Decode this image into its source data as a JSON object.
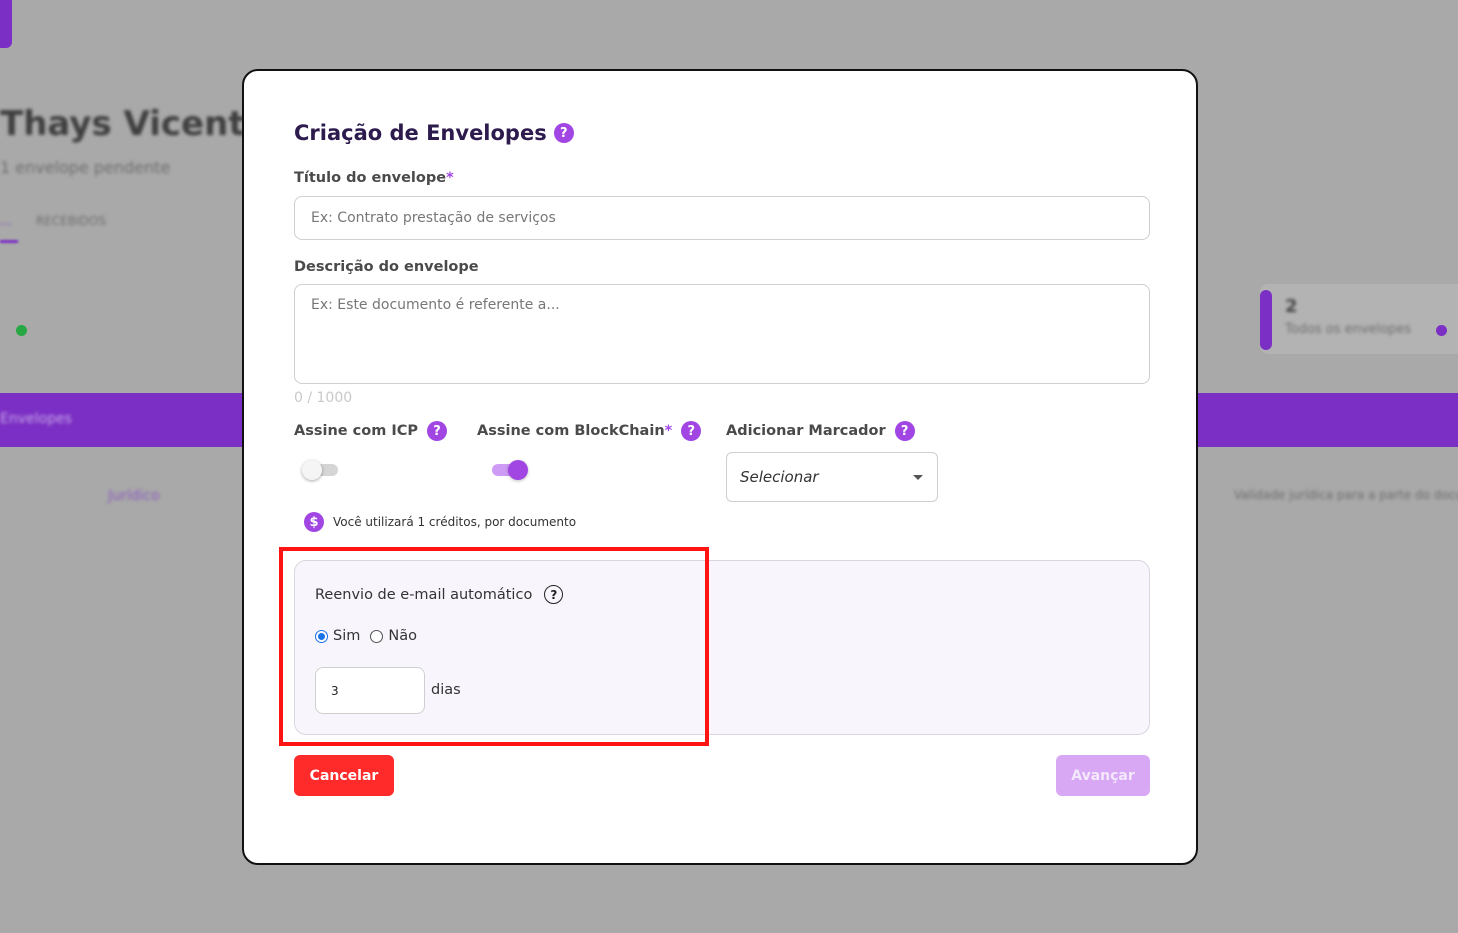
{
  "background": {
    "greeting": "Thays Vicente!",
    "subtitle": "1 envelope pendente",
    "tab_first": "...",
    "tab_second": "RECEBIDOS",
    "band_label": "Envelopes",
    "card_count": "2",
    "card_label": "Todos os envelopes",
    "row_left": "Jurídico",
    "row_right": "Validade jurídica para a parte do documento"
  },
  "modal": {
    "title": "Criação de Envelopes",
    "title_help": "?",
    "title_field": {
      "label": "Título do envelope",
      "required_mark": "*",
      "value": "",
      "placeholder": "Ex: Contrato prestação de serviços"
    },
    "description_field": {
      "label": "Descrição do envelope",
      "value": "",
      "placeholder": "Ex: Este documento é referente a...",
      "counter": "0 / 1000"
    },
    "icp": {
      "label": "Assine com ICP",
      "help": "?",
      "enabled": false
    },
    "blockchain": {
      "label": "Assine com BlockChain",
      "required_mark": "*",
      "help": "?",
      "enabled": true
    },
    "marker": {
      "label": "Adicionar Marcador",
      "help": "?",
      "selected": "Selecionar"
    },
    "credits": {
      "icon": "$",
      "text": "Você utilizará 1 créditos, por documento"
    },
    "auto_resend": {
      "title": "Reenvio de e-mail automático",
      "help": "?",
      "options": [
        {
          "label": "Sim",
          "checked": true
        },
        {
          "label": "Não",
          "checked": false
        }
      ],
      "days_value": "3",
      "days_unit": "dias"
    },
    "buttons": {
      "cancel": "Cancelar",
      "next": "Avançar"
    }
  },
  "colors": {
    "accent": "#a146e3",
    "title": "#2d1b4e",
    "cancel": "#ff2a2a",
    "next_disabled": "#d8a8f5",
    "highlight": "#ff1414"
  },
  "icons": {
    "help": "question-circle-icon",
    "credits": "dollar-coin-icon",
    "select": "caret-down-icon"
  }
}
